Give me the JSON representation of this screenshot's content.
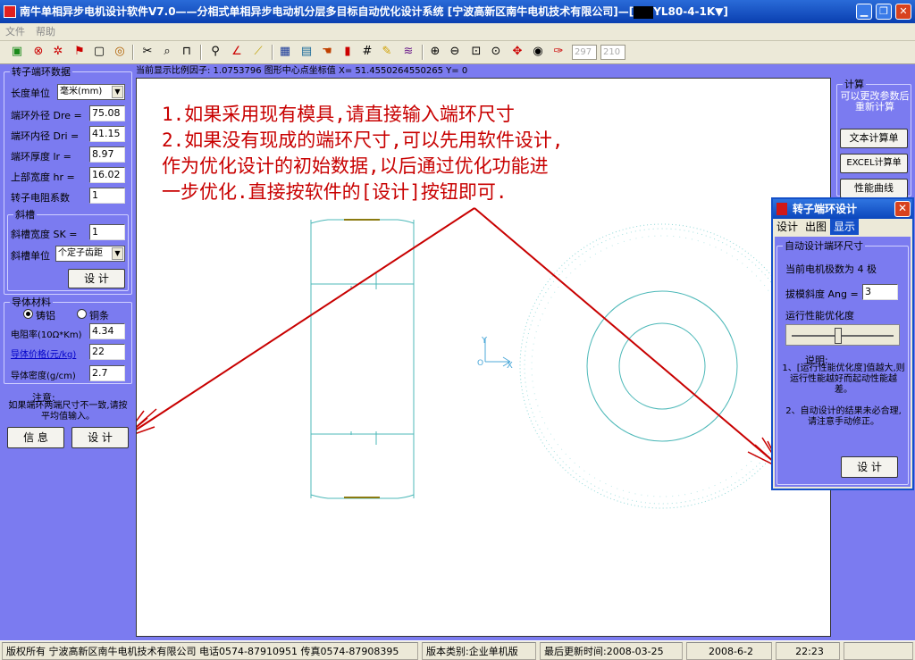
{
  "window": {
    "title": "南牛单相异步电机设计软件V7.0——分相式单相异步电动机分层多目标自动优化设计系统  [宁波高新区南牛电机技术有限公司]—[",
    "title_tail": "YL80-4-1K▼]",
    "minimize": "▁",
    "restore": "❐",
    "close": "✕"
  },
  "menu": {
    "file": "文件",
    "help": "帮助"
  },
  "toolbar": {
    "input1": "297",
    "input2": "210"
  },
  "left_panel": {
    "title": "转子端环数据",
    "length_unit_label": "长度单位",
    "length_unit_value": "毫米(mm)",
    "dre_label": "端环外径 Dre =",
    "dre_value": "75.08",
    "dri_label": "端环内径 Dri =",
    "dri_value": "41.15",
    "lr_label": "端环厚度  lr =",
    "lr_value": "8.97",
    "hr_label": "上部宽度  hr =",
    "hr_value": "16.02",
    "coef_label": "转子电阻系数",
    "coef_value": "1",
    "skew_group": "斜槽",
    "skew_width_label": "斜槽宽度   SK =",
    "skew_width_value": "1",
    "skew_unit_label": "斜槽单位",
    "skew_unit_value": "个定子齿距",
    "design_btn": "设  计",
    "material_group": "导体材料",
    "al_label": "铸铝",
    "cu_label": "铜条",
    "resist_label": "电阻率(10Ω*Km)",
    "resist_value": "4.34",
    "price_label": "导体价格(元/kg)",
    "price_value": "22",
    "density_label": "导体密度(g/cm)",
    "density_value": "2.7",
    "note_title": "注意:",
    "note_text": "如果端环两端尺寸不一致,请按平均值输入。",
    "info_btn": "信  息",
    "design_btn2": "设  计"
  },
  "scale_info": "当前显示比例因子: 1.0753796  图形中心点坐标值 X= 51.4550264550265 Y= 0",
  "annotation": {
    "line1": "1.如果采用现有模具,请直接输入端环尺寸",
    "line2": "2.如果没有现成的端环尺寸,可以先用软件设计,",
    "line3": "作为优化设计的初始数据,以后通过优化功能进",
    "line4": "一步优化.直接按软件的[设计]按钮即可."
  },
  "canvas_axes": {
    "y": "Y",
    "o": "O",
    "x": "X"
  },
  "right_panel": {
    "group": "计算",
    "note": "可以更改参数后重新计算",
    "text_calc_btn": "文本计算单",
    "excel_calc_btn": "EXCEL计算单",
    "perf_curve_btn": "性能曲线"
  },
  "dialog": {
    "title": "转子端环设计",
    "tabs": [
      "设计",
      "出图",
      "显示"
    ],
    "active_tab": 2,
    "group": "自动设计端环尺寸",
    "poles": "当前电机极数为 4 极",
    "draft_label": "拔模斜度 Ang =",
    "draft_value": "3",
    "optimize_label": "运行性能优化度",
    "slider_value": 0.45,
    "explain_title": "说明:",
    "explain1": "1、[运行性能优化度]值越大,则运行性能越好而起动性能越差。",
    "explain2": "2、自动设计的结果未必合理,请注意手动修正。",
    "design_btn": "设  计"
  },
  "status": {
    "copyright": "版权所有 宁波高新区南牛电机技术有限公司 电话0574-87910951 传真0574-87908395",
    "edition": "版本类别:企业单机版",
    "updated": "最后更新时间:2008-03-25",
    "date": "2008-6-2",
    "time": "22:23"
  },
  "colors": {
    "accent": "#7b7bf0",
    "annotation": "#c80000",
    "drawing": "#4cb8b8"
  }
}
